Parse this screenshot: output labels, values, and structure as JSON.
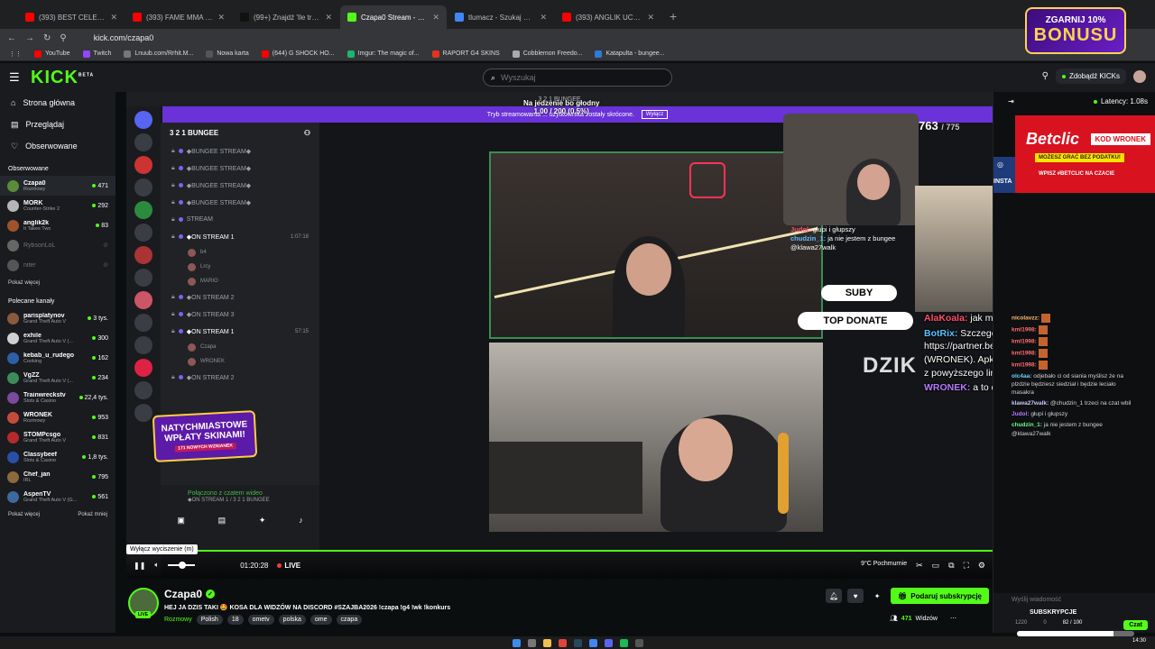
{
  "browser": {
    "tabs": [
      {
        "title": "(393) BEST CELEBRITY LOOKAL",
        "color": "#ff0000",
        "active": false
      },
      {
        "title": "(393) FAME MMA 1: Michał Hu",
        "color": "#ff0000",
        "active": false
      },
      {
        "title": "(99+) Znajdź 'Ile trzeba wziąć s",
        "color": "#111111",
        "active": false
      },
      {
        "title": "Czapa0 Stream - Watch Live on",
        "color": "#53fc18",
        "active": true
      },
      {
        "title": "tlumacz - Szukaj w Google",
        "color": "#4285f4",
        "active": false
      },
      {
        "title": "(393) ANGLIK UCZY MNIE ANG",
        "color": "#ff0000",
        "active": false
      }
    ],
    "url": "kick.com/czapa0",
    "bookmarks": [
      {
        "label": "YouTube",
        "color": "#ff0000"
      },
      {
        "label": "Twitch",
        "color": "#9146ff"
      },
      {
        "label": "Lnuub.com/Rrhit.M...",
        "color": "#777777"
      },
      {
        "label": "Nowa karta",
        "color": "#555555"
      },
      {
        "label": "(644) G SHOCK HO...",
        "color": "#ff0000"
      },
      {
        "label": "Imgur: The magic of...",
        "color": "#1bb76e"
      },
      {
        "label": "RAPORT G4 SKINS",
        "color": "#e1341e"
      },
      {
        "label": "Cobblemon Freedo...",
        "color": "#aaaaaa"
      },
      {
        "label": "Katapulta - bungee...",
        "color": "#2e7bd6"
      }
    ],
    "ad": {
      "line1": "ZGARNIJ 10%",
      "line2": "BONUSU"
    }
  },
  "kick": {
    "logo": "KICK",
    "logo_sup": "BETA",
    "search_placeholder": "Wyszukaj",
    "get_kicks": "Zdobądź KICKs"
  },
  "sidebar": {
    "nav": [
      {
        "label": "Strona główna",
        "icon": "⌂"
      },
      {
        "label": "Przeglądaj",
        "icon": "▤"
      },
      {
        "label": "Obserwowane",
        "icon": "♡"
      }
    ],
    "followed_title": "Obserwowane",
    "followed": [
      {
        "name": "Czapa0",
        "category": "Rozmowy",
        "viewers": "471",
        "color": "#5a8c3a",
        "live": true
      },
      {
        "name": "MORK",
        "category": "Counter-Strike 2",
        "viewers": "292",
        "color": "#b5b5b5",
        "live": true
      },
      {
        "name": "anglik2k",
        "category": "It Takes Two",
        "viewers": "83",
        "color": "#a0522d",
        "live": true
      },
      {
        "name": "RybsonLoL",
        "category": "",
        "viewers": "",
        "color": "#666666",
        "live": false
      },
      {
        "name": "niter",
        "category": "",
        "viewers": "",
        "color": "#555555",
        "live": false
      }
    ],
    "show_more": "Pokaż więcej",
    "recommended_title": "Polecane kanały",
    "recommended": [
      {
        "name": "parisplatynov",
        "category": "Grand Theft Auto V",
        "viewers": "3 tys.",
        "color": "#8a5a3c"
      },
      {
        "name": "exhile",
        "category": "Grand Theft Auto V (...",
        "viewers": "300",
        "color": "#d0d0d0"
      },
      {
        "name": "kebab_u_rudego",
        "category": "Cooking",
        "viewers": "162",
        "color": "#2d5fa8"
      },
      {
        "name": "VgZZ",
        "category": "Grand Theft Auto V (...",
        "viewers": "234",
        "color": "#3c8c5a"
      },
      {
        "name": "Trainwreckstv",
        "category": "Slots & Casino",
        "viewers": "22,4 tys.",
        "color": "#7a4a9c"
      },
      {
        "name": "WRONEK",
        "category": "Rozmowy",
        "viewers": "953",
        "color": "#c44b3c"
      },
      {
        "name": "STOMPcsgo",
        "category": "Grand Theft Auto V",
        "viewers": "831",
        "color": "#b52a2a"
      },
      {
        "name": "Classybeef",
        "category": "Slots & Casino",
        "viewers": "1,8 tys.",
        "color": "#2a4fa8"
      },
      {
        "name": "Chef_jan",
        "category": "IRL",
        "viewers": "795",
        "color": "#8c6a3c"
      },
      {
        "name": "AspenTV",
        "category": "Grand Theft Auto V (G...",
        "viewers": "561",
        "color": "#3c6a9c"
      }
    ],
    "show_more_2": "Pokaż więcej",
    "show_less": "Pokaż mniej"
  },
  "video": {
    "discord_title": "3 2 1 BUNGEE",
    "notice": "Tryb streamowania ... użytkownika zostały skrócone.",
    "notice_btn": "Wyłącz",
    "hunger_title": "Na jedzenie bo głodny",
    "hunger_value": "1.00 / 200 (0.5%)",
    "server_name": "3 2 1 BUNGEE",
    "voice_channels": [
      {
        "label": "◆BUNGEE STREAM◆",
        "live": false,
        "time": ""
      },
      {
        "label": "◆BUNGEE STREAM◆",
        "live": false,
        "time": ""
      },
      {
        "label": "◆BUNGEE STREAM◆",
        "live": false,
        "time": ""
      },
      {
        "label": "◆BUNGEE STREAM◆",
        "live": false,
        "time": ""
      },
      {
        "label": "STREAM",
        "live": false,
        "time": ""
      },
      {
        "label": "◆ON STREAM 1",
        "live": true,
        "time": "1:07:18"
      }
    ],
    "vc_users_1": [
      "b4",
      "Lrcy",
      "MARIO"
    ],
    "voice_channels_2": [
      {
        "label": "◆ON STREAM 2",
        "live": false,
        "time": ""
      },
      {
        "label": "◆ON STREAM 3",
        "live": false,
        "time": ""
      },
      {
        "label": "◆ON STREAM 1",
        "live": true,
        "time": "57:15"
      }
    ],
    "vc_users_2": [
      "Czapa",
      "WRONEK"
    ],
    "voice_channels_3": [
      {
        "label": "◆ON STREAM 2",
        "live": false,
        "time": ""
      }
    ],
    "promo": "NATYCHMIASTOWE WPŁATY SKINAMI!",
    "promo_sub": "171 NOWYCH WZNIANEK",
    "connected": "Połączono z czatem wideo",
    "connected_sub": "◆ON STREAM 1 / 3 2 1 BUNGEE",
    "counter": "763",
    "counter_max": "/ 775",
    "suby": "SUBY",
    "top_donate": "TOP DONATE",
    "brand_overlay": "DZIK",
    "minichat": [
      {
        "user": "Judol:",
        "text": "głupi i głupszy",
        "cls": "u1"
      },
      {
        "user": "chudzin_1:",
        "text": "ja nie jestem z bungee @klawa27walk",
        "cls": "u2"
      }
    ],
    "overlay_chat": [
      {
        "user": "AlaKoala:",
        "text": "jak mnie kochasz to się odezwij",
        "color": "#ff4f6a"
      },
      {
        "user": "BotRix:",
        "text": "Szczegóły na temat oferty Betclic: https://partner.betclic.pl/wronek/ KOD promo: (WRONEK). Apkę Betclic można pobrać korzystając z powyższego linku.",
        "color": "#59c3ff"
      },
      {
        "user": "WRONEK:",
        "text": "a to do mnie czy do czapy",
        "color": "#b678ff"
      }
    ],
    "tooltip": "Wyłącz wyciszenie (m)",
    "time": "01:20:28",
    "live_label": "LIVE",
    "weather": "9°C Pochmurnie"
  },
  "chat": {
    "latency": "Latency: 1.08s",
    "betclic": {
      "brand": "Betclic",
      "code_label": "KOD",
      "code": "WRONEK",
      "line1": "MOŻESZ GRAĆ BEZ PODATKU!",
      "line2": "WPISZ #BETCLIC NA CZACIE"
    },
    "instagram": "INSTA",
    "messages": [
      {
        "user": "nicolavzz:",
        "text": "",
        "color": "#ffb86b"
      },
      {
        "user": "kml1998:",
        "text": "",
        "color": "#ff6b6b"
      },
      {
        "user": "kml1998:",
        "text": "",
        "color": "#ff6b6b"
      },
      {
        "user": "kml1998:",
        "text": "",
        "color": "#ff6b6b"
      },
      {
        "user": "kml1998:",
        "text": "",
        "color": "#ff6b6b"
      },
      {
        "user": "olc4aa:",
        "text": "odjebało ci od siania myślisz że na plzdzie będziesz siedział i będzie leciało masakra",
        "color": "#6bd1ff"
      },
      {
        "user": "klawa27walk:",
        "text": "@chudzin_1 trzeci na czat wbil",
        "color": "#c8c8ff"
      },
      {
        "user": "Judol:",
        "text": "głupi i głupszy",
        "color": "#b678ff"
      },
      {
        "user": "chudzin_1:",
        "text": "ja nie jestem z bungee @klawa27walk",
        "color": "#6bff8a"
      }
    ],
    "input_placeholder": "Wyślij wiadomość",
    "sub_label": "SUBSKRYPCJE",
    "sub_left": "1220",
    "sub_mid": "0",
    "sub_progress": "82 / 100",
    "chat_btn": "Czat"
  },
  "stream": {
    "name": "Czapa0",
    "title": "HEJ JA DZIS TAKI 🤩 KOSA DLA WIDZÓW NA DISCORD #SZAJBA2026 !czapa !g4 !wk !konkurs",
    "category": "Rozmowy",
    "tags": [
      "Polish",
      "18",
      "ometv",
      "polska",
      "ome",
      "czapa"
    ],
    "subscribe": "Podaruj subskrypcję",
    "viewers": "471",
    "viewers_label": "Widzów",
    "live_badge": "LIVE"
  },
  "taskbar": {
    "clock": "14:30"
  }
}
